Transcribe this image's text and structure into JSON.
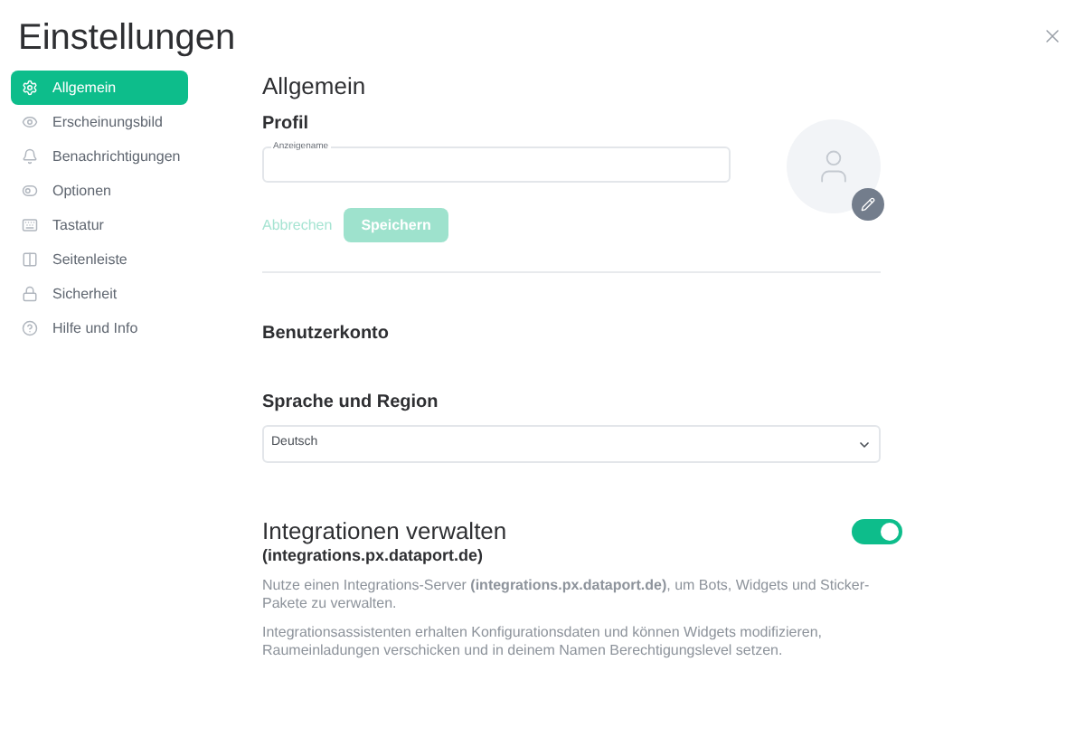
{
  "title": "Einstellungen",
  "sidebar": {
    "items": [
      {
        "label": "Allgemein",
        "selected": true
      },
      {
        "label": "Erscheinungsbild",
        "selected": false
      },
      {
        "label": "Benachrichtigungen",
        "selected": false
      },
      {
        "label": "Optionen",
        "selected": false
      },
      {
        "label": "Tastatur",
        "selected": false
      },
      {
        "label": "Seitenleiste",
        "selected": false
      },
      {
        "label": "Sicherheit",
        "selected": false
      },
      {
        "label": "Hilfe und Info",
        "selected": false
      }
    ]
  },
  "main": {
    "heading": "Allgemein",
    "profile": {
      "heading": "Profil",
      "display_name_label": "Anzeigename",
      "cancel": "Abbrechen",
      "save": "Speichern",
      "save_disabled": true
    },
    "account": {
      "heading": "Benutzerkonto"
    },
    "language": {
      "heading": "Sprache und Region",
      "value": "Deutsch"
    },
    "integrations": {
      "heading": "Integrationen verwalten",
      "subheading": "(integrations.px.dataport.de)",
      "on": true,
      "paragraphs": [
        "Nutze einen Integrations-Server **(integrations.px.dataport.de)**, um Bots, Widgets und Sticker-Pakete zu verwalten.",
        "Integrationsassistenten erhalten Konfigurationsdaten und können Widgets modifizieren, Raumeinladungen verschicken und in deinem Namen Berechtigungslevel setzen."
      ]
    }
  }
}
